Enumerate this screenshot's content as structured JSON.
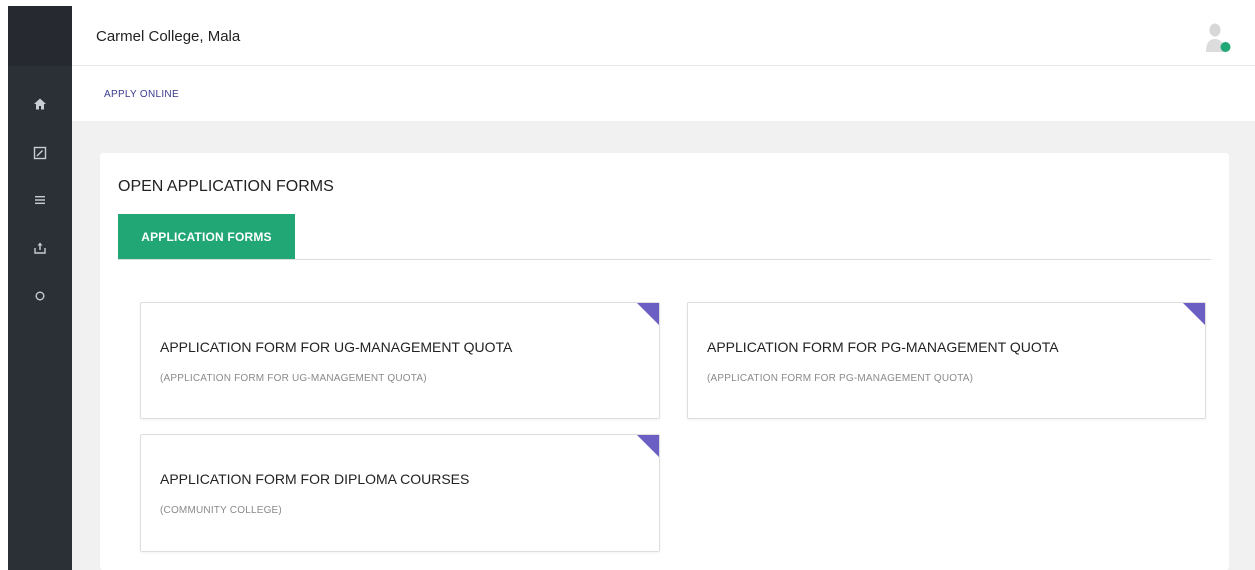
{
  "header": {
    "title": "Carmel College, Mala"
  },
  "breadcrumb": {
    "label": "APPLY ONLINE"
  },
  "sidebar": {
    "items": [
      {
        "icon": "home-icon"
      },
      {
        "icon": "edit-icon"
      },
      {
        "icon": "menu-icon"
      },
      {
        "icon": "upload-icon"
      },
      {
        "icon": "circle-icon"
      }
    ]
  },
  "main": {
    "title": "OPEN APPLICATION FORMS",
    "tabs": [
      {
        "label": "APPLICATION FORMS",
        "active": true
      }
    ],
    "forms": [
      {
        "name": "APPLICATION FORM FOR UG-MANAGEMENT QUOTA",
        "subtitle": "(APPLICATION FORM FOR UG-MANAGEMENT QUOTA)"
      },
      {
        "name": "APPLICATION FORM FOR PG-MANAGEMENT QUOTA",
        "subtitle": "(APPLICATION FORM FOR PG-MANAGEMENT QUOTA)"
      },
      {
        "name": "APPLICATION FORM FOR DIPLOMA COURSES",
        "subtitle": "(COMMUNITY COLLEGE)"
      }
    ]
  },
  "colors": {
    "sidebar": "#2b2f36",
    "accent_green": "#21a776",
    "corner_purple": "#6c5fc4",
    "online_dot": "#21a776"
  }
}
